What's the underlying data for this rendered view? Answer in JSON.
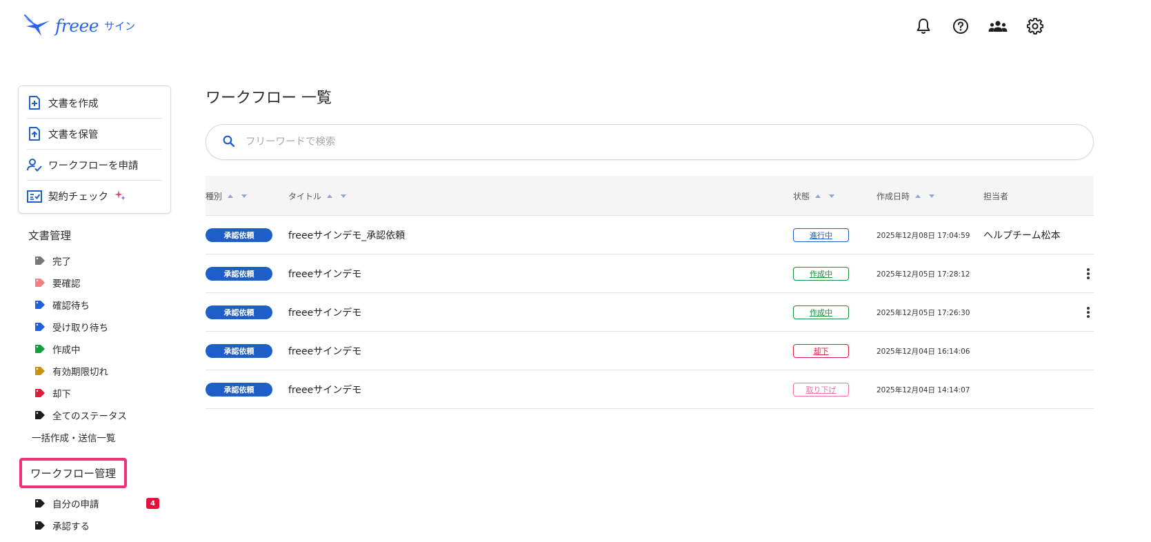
{
  "header": {
    "logo_text": "freee",
    "logo_sub": "サイン",
    "icons": [
      "bell-icon",
      "help-icon",
      "team-icon",
      "settings-icon"
    ]
  },
  "sidebar": {
    "actions": [
      {
        "label": "文書を作成",
        "icon": "document-add-icon"
      },
      {
        "label": "文書を保管",
        "icon": "document-upload-icon"
      },
      {
        "label": "ワークフローを申請",
        "icon": "user-check-icon"
      },
      {
        "label": "契約チェック",
        "icon": "checklist-icon"
      }
    ],
    "doc_section_title": "文書管理",
    "doc_tags": [
      {
        "label": "完了",
        "color": "#767676"
      },
      {
        "label": "要確認",
        "color": "#f07f83"
      },
      {
        "label": "確認待ち",
        "color": "#2160d6"
      },
      {
        "label": "受け取り待ち",
        "color": "#2160d6"
      },
      {
        "label": "作成中",
        "color": "#12a03c"
      },
      {
        "label": "有効期限切れ",
        "color": "#c99212"
      },
      {
        "label": "却下",
        "color": "#e01c3c"
      },
      {
        "label": "全てのステータス",
        "color": "#1d1d1d"
      }
    ],
    "bulk_link": "一括作成・送信一覧",
    "wf_section_title": "ワークフロー管理",
    "wf_items": [
      {
        "label": "自分の申請",
        "color": "#1d1d1d",
        "badge": "4"
      },
      {
        "label": "承認する",
        "color": "#1d1d1d",
        "badge": ""
      }
    ]
  },
  "main": {
    "page_title": "ワークフロー 一覧",
    "search_placeholder": "フリーワードで検索",
    "columns": {
      "kind": "種別",
      "title": "タイトル",
      "status": "状態",
      "created": "作成日時",
      "owner": "担当者"
    },
    "rows": [
      {
        "kind": "承認依頼",
        "title": "freeeサインデモ_承認依頼",
        "status": "進行中",
        "status_color": "#1e5ec9",
        "created": "2025年12月08日 17:04:59",
        "owner": "ヘルプチーム松本",
        "menu": false
      },
      {
        "kind": "承認依頼",
        "title": "freeeサインデモ",
        "status": "作成中",
        "status_color": "#12913a",
        "created": "2025年12月05日 17:28:12",
        "owner": "",
        "menu": true
      },
      {
        "kind": "承認依頼",
        "title": "freeeサインデモ",
        "status": "作成中",
        "status_color": "#12913a",
        "created": "2025年12月05日 17:26:30",
        "owner": "",
        "menu": true
      },
      {
        "kind": "承認依頼",
        "title": "freeeサインデモ",
        "status": "却下",
        "status_color": "#e01c3c",
        "created": "2025年12月04日 16:14:06",
        "owner": "",
        "menu": false
      },
      {
        "kind": "承認依頼",
        "title": "freeeサインデモ",
        "status": "取り下げ",
        "status_color": "#f06fa0",
        "created": "2025年12月04日 14:14:07",
        "owner": "",
        "menu": false
      }
    ]
  }
}
